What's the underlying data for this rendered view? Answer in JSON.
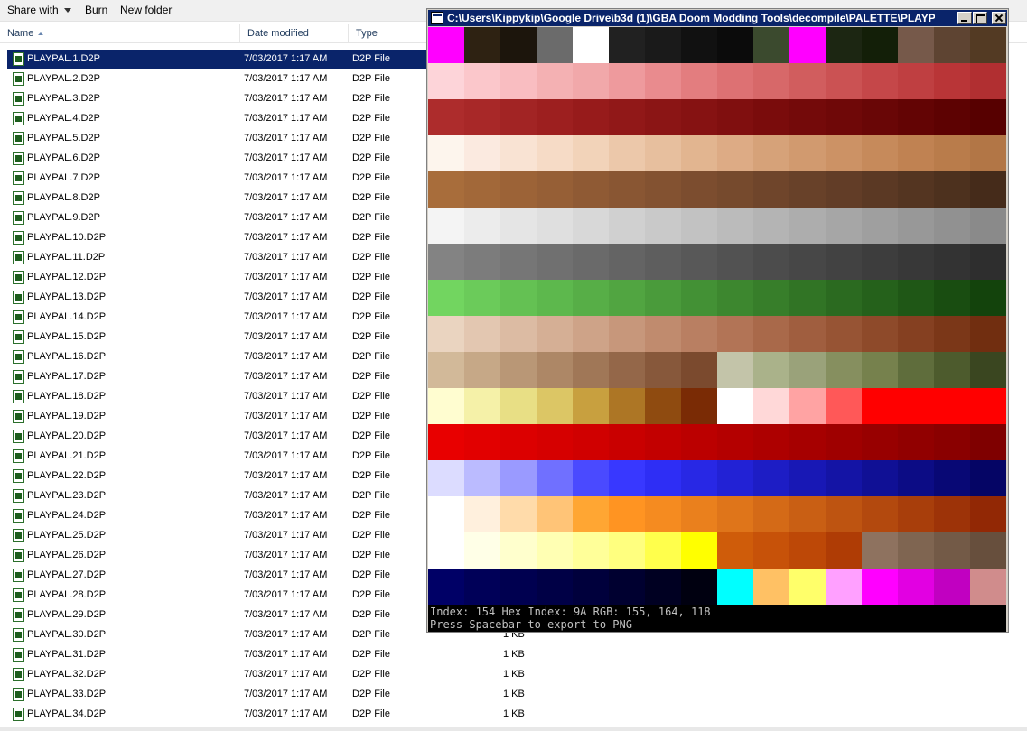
{
  "toolbar": {
    "share_with": "Share with",
    "burn": "Burn",
    "new_folder": "New folder"
  },
  "columns": {
    "name": "Name",
    "date_modified": "Date modified",
    "type": "Type"
  },
  "files": [
    {
      "name": "PLAYPAL.1.D2P",
      "date": "7/03/2017 1:17 AM",
      "type": "D2P File",
      "size": "",
      "selected": true
    },
    {
      "name": "PLAYPAL.2.D2P",
      "date": "7/03/2017 1:17 AM",
      "type": "D2P File",
      "size": ""
    },
    {
      "name": "PLAYPAL.3.D2P",
      "date": "7/03/2017 1:17 AM",
      "type": "D2P File",
      "size": ""
    },
    {
      "name": "PLAYPAL.4.D2P",
      "date": "7/03/2017 1:17 AM",
      "type": "D2P File",
      "size": ""
    },
    {
      "name": "PLAYPAL.5.D2P",
      "date": "7/03/2017 1:17 AM",
      "type": "D2P File",
      "size": ""
    },
    {
      "name": "PLAYPAL.6.D2P",
      "date": "7/03/2017 1:17 AM",
      "type": "D2P File",
      "size": ""
    },
    {
      "name": "PLAYPAL.7.D2P",
      "date": "7/03/2017 1:17 AM",
      "type": "D2P File",
      "size": ""
    },
    {
      "name": "PLAYPAL.8.D2P",
      "date": "7/03/2017 1:17 AM",
      "type": "D2P File",
      "size": ""
    },
    {
      "name": "PLAYPAL.9.D2P",
      "date": "7/03/2017 1:17 AM",
      "type": "D2P File",
      "size": ""
    },
    {
      "name": "PLAYPAL.10.D2P",
      "date": "7/03/2017 1:17 AM",
      "type": "D2P File",
      "size": ""
    },
    {
      "name": "PLAYPAL.11.D2P",
      "date": "7/03/2017 1:17 AM",
      "type": "D2P File",
      "size": ""
    },
    {
      "name": "PLAYPAL.12.D2P",
      "date": "7/03/2017 1:17 AM",
      "type": "D2P File",
      "size": ""
    },
    {
      "name": "PLAYPAL.13.D2P",
      "date": "7/03/2017 1:17 AM",
      "type": "D2P File",
      "size": ""
    },
    {
      "name": "PLAYPAL.14.D2P",
      "date": "7/03/2017 1:17 AM",
      "type": "D2P File",
      "size": ""
    },
    {
      "name": "PLAYPAL.15.D2P",
      "date": "7/03/2017 1:17 AM",
      "type": "D2P File",
      "size": ""
    },
    {
      "name": "PLAYPAL.16.D2P",
      "date": "7/03/2017 1:17 AM",
      "type": "D2P File",
      "size": ""
    },
    {
      "name": "PLAYPAL.17.D2P",
      "date": "7/03/2017 1:17 AM",
      "type": "D2P File",
      "size": ""
    },
    {
      "name": "PLAYPAL.18.D2P",
      "date": "7/03/2017 1:17 AM",
      "type": "D2P File",
      "size": ""
    },
    {
      "name": "PLAYPAL.19.D2P",
      "date": "7/03/2017 1:17 AM",
      "type": "D2P File",
      "size": ""
    },
    {
      "name": "PLAYPAL.20.D2P",
      "date": "7/03/2017 1:17 AM",
      "type": "D2P File",
      "size": ""
    },
    {
      "name": "PLAYPAL.21.D2P",
      "date": "7/03/2017 1:17 AM",
      "type": "D2P File",
      "size": ""
    },
    {
      "name": "PLAYPAL.22.D2P",
      "date": "7/03/2017 1:17 AM",
      "type": "D2P File",
      "size": ""
    },
    {
      "name": "PLAYPAL.23.D2P",
      "date": "7/03/2017 1:17 AM",
      "type": "D2P File",
      "size": ""
    },
    {
      "name": "PLAYPAL.24.D2P",
      "date": "7/03/2017 1:17 AM",
      "type": "D2P File",
      "size": ""
    },
    {
      "name": "PLAYPAL.25.D2P",
      "date": "7/03/2017 1:17 AM",
      "type": "D2P File",
      "size": ""
    },
    {
      "name": "PLAYPAL.26.D2P",
      "date": "7/03/2017 1:17 AM",
      "type": "D2P File",
      "size": ""
    },
    {
      "name": "PLAYPAL.27.D2P",
      "date": "7/03/2017 1:17 AM",
      "type": "D2P File",
      "size": ""
    },
    {
      "name": "PLAYPAL.28.D2P",
      "date": "7/03/2017 1:17 AM",
      "type": "D2P File",
      "size": ""
    },
    {
      "name": "PLAYPAL.29.D2P",
      "date": "7/03/2017 1:17 AM",
      "type": "D2P File",
      "size": ""
    },
    {
      "name": "PLAYPAL.30.D2P",
      "date": "7/03/2017 1:17 AM",
      "type": "D2P File",
      "size": "1 KB"
    },
    {
      "name": "PLAYPAL.31.D2P",
      "date": "7/03/2017 1:17 AM",
      "type": "D2P File",
      "size": "1 KB"
    },
    {
      "name": "PLAYPAL.32.D2P",
      "date": "7/03/2017 1:17 AM",
      "type": "D2P File",
      "size": "1 KB"
    },
    {
      "name": "PLAYPAL.33.D2P",
      "date": "7/03/2017 1:17 AM",
      "type": "D2P File",
      "size": "1 KB"
    },
    {
      "name": "PLAYPAL.34.D2P",
      "date": "7/03/2017 1:17 AM",
      "type": "D2P File",
      "size": "1 KB"
    }
  ],
  "palette_window": {
    "title": "C:\\Users\\Kippykip\\Google Drive\\b3d (1)\\GBA Doom Modding Tools\\decompile\\PALETTE\\PLAYPAL....",
    "console_line1": "Index: 154 Hex Index: 9A RGB: 155, 164, 118",
    "console_line2": "Press Spacebar to export to PNG",
    "colors": [
      [
        "#ff00ff",
        "#2e2212",
        "#1c150c",
        "#6b6b6b",
        "#ffffff",
        "#212121",
        "#1a1a1a",
        "#111111",
        "#0b0b0b",
        "#3b4a2e",
        "#ff00ff",
        "#1c2612",
        "#131f08",
        "#76594a",
        "#5e4432",
        "#533a23"
      ],
      [
        "#fdd4d9",
        "#fbc7cb",
        "#f9bdc1",
        "#f4b1b3",
        "#f1a8aa",
        "#ee9a9d",
        "#e98b8e",
        "#e37d7f",
        "#dd7173",
        "#d76869",
        "#d15d5e",
        "#cb5253",
        "#c54749",
        "#bf3f41",
        "#b93537",
        "#b12f31"
      ],
      [
        "#ad2c2c",
        "#a82828",
        "#a22424",
        "#9d1f1f",
        "#971b1b",
        "#911818",
        "#8b1515",
        "#861212",
        "#800f0f",
        "#7a0c0c",
        "#740a0a",
        "#6f0808",
        "#690606",
        "#630404",
        "#5d0202",
        "#570000"
      ],
      [
        "#fdf5ed",
        "#fbeae0",
        "#f9e3d3",
        "#f6dbc6",
        "#f2d3b9",
        "#ecc8aa",
        "#e7bf9e",
        "#e2b590",
        "#ddab85",
        "#d6a279",
        "#d19a6f",
        "#cc9265",
        "#c68a5b",
        "#c08252",
        "#b97c4b",
        "#b27646"
      ],
      [
        "#a86d3b",
        "#a26839",
        "#9c6337",
        "#965f36",
        "#8f5a34",
        "#895633",
        "#835231",
        "#7c4d2f",
        "#764a2d",
        "#6f452b",
        "#684129",
        "#623d27",
        "#5b3924",
        "#543521",
        "#4d311e",
        "#452b1a"
      ],
      [
        "#f4f4f4",
        "#ececec",
        "#e5e5e5",
        "#dfdfdf",
        "#d8d8d8",
        "#d0d0d0",
        "#c9c9c9",
        "#c2c2c2",
        "#bbbbbb",
        "#b4b4b4",
        "#adadad",
        "#a6a6a6",
        "#9f9f9f",
        "#989898",
        "#919191",
        "#8a8a8a"
      ],
      [
        "#838383",
        "#7c7c7c",
        "#767676",
        "#707070",
        "#6a6a6a",
        "#646464",
        "#5e5e5e",
        "#585858",
        "#525252",
        "#4c4c4c",
        "#474747",
        "#424242",
        "#3d3d3d",
        "#383838",
        "#333333",
        "#2e2e2e"
      ],
      [
        "#72d560",
        "#6bcb5a",
        "#64c153",
        "#5db84d",
        "#57ae47",
        "#51a541",
        "#4a9b3b",
        "#439135",
        "#3d872f",
        "#377e2a",
        "#317425",
        "#2b6a20",
        "#25611b",
        "#1f5716",
        "#194d11",
        "#13430c"
      ],
      [
        "#ead4c0",
        "#e3c7b1",
        "#dcbba3",
        "#d5af95",
        "#cea388",
        "#c7977b",
        "#c08b6e",
        "#b97f62",
        "#b27456",
        "#a9694a",
        "#a05e3f",
        "#975434",
        "#8e4a2a",
        "#854021",
        "#7b3718",
        "#712e10"
      ],
      [
        "#d2b999",
        "#c6a887",
        "#b99776",
        "#ad8766",
        "#a07757",
        "#946749",
        "#87583b",
        "#7b4a2e",
        "#c3c4a9",
        "#aab28a",
        "#9aa27a",
        "#868f5f",
        "#76814d",
        "#5f6d3c",
        "#4d5b2d",
        "#3a4620"
      ],
      [
        "#fffdd0",
        "#f5f1a8",
        "#e8df85",
        "#dcc665",
        "#c8a03f",
        "#ad7625",
        "#8f4b10",
        "#7a2b05",
        "#ffffff",
        "#ffd8d8",
        "#ffa3a3",
        "#ff5858",
        "#ff0000",
        "#ff0000",
        "#ff0000",
        "#ff0000"
      ],
      [
        "#e80000",
        "#e20000",
        "#dc0000",
        "#d60000",
        "#d00000",
        "#c90000",
        "#c20000",
        "#bb0000",
        "#b40000",
        "#ad0000",
        "#a60000",
        "#9f0000",
        "#980000",
        "#910000",
        "#8a0000",
        "#7f0000"
      ],
      [
        "#dcdcff",
        "#bbbbff",
        "#9a9aff",
        "#7070ff",
        "#4a4aff",
        "#3838ff",
        "#2e2ef5",
        "#2828e5",
        "#2222d5",
        "#1d1dc5",
        "#1818b5",
        "#1414a5",
        "#101095",
        "#0c0c85",
        "#080875",
        "#050565"
      ],
      [
        "#ffffff",
        "#fff0dd",
        "#ffdbaa",
        "#ffc477",
        "#ffa633",
        "#ff9422",
        "#f58b20",
        "#ea801d",
        "#df751a",
        "#d46a17",
        "#c95f14",
        "#be5411",
        "#b3490e",
        "#a83e0b",
        "#9d3308",
        "#922805"
      ],
      [
        "#ffffff",
        "#ffffe7",
        "#ffffcd",
        "#ffffb3",
        "#ffff99",
        "#ffff7f",
        "#ffff4c",
        "#ffff00",
        "#cf5c0a",
        "#c75209",
        "#bd4807",
        "#af3c05",
        "#8e725f",
        "#7f6551",
        "#735a47",
        "#674f3d"
      ],
      [
        "#000066",
        "#000058",
        "#000050",
        "#000046",
        "#00003c",
        "#000030",
        "#000022",
        "#000010",
        "#00ffff",
        "#ffc164",
        "#ffff6a",
        "#ffa0ff",
        "#ff00ff",
        "#e200e2",
        "#c100c1",
        "#9d009d"
      ]
    ],
    "last_color": "#d08c8c"
  }
}
